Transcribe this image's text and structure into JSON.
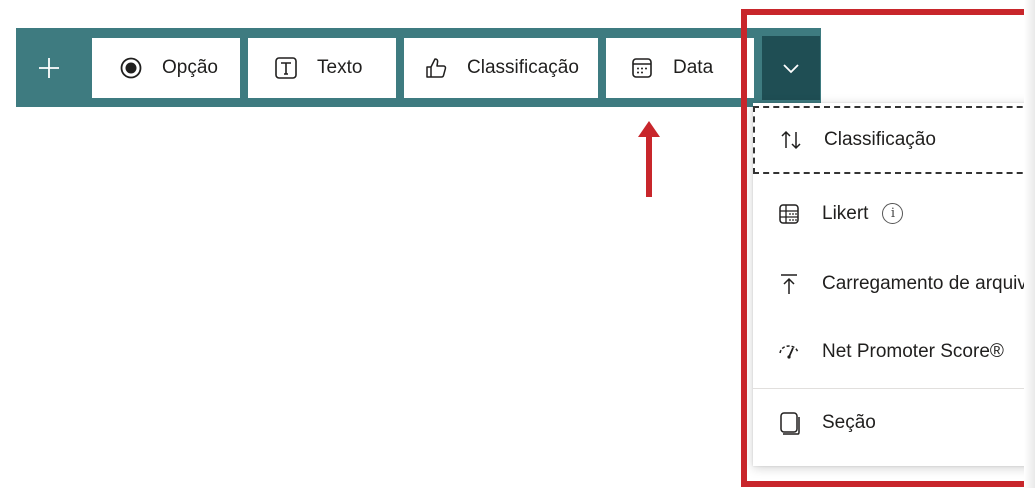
{
  "toolbar": {
    "buttons": [
      {
        "label": "Opção",
        "icon": "radio-icon"
      },
      {
        "label": "Texto",
        "icon": "text-box-icon"
      },
      {
        "label": "Classificação",
        "icon": "thumbs-up-icon"
      },
      {
        "label": "Data",
        "icon": "calendar-icon"
      }
    ],
    "add_icon": "plus-icon",
    "expand_icon": "chevron-down-icon"
  },
  "dropdown": {
    "items": [
      {
        "label": "Classificação",
        "icon": "sort-arrows-icon"
      },
      {
        "label": "Likert",
        "icon": "likert-table-icon"
      },
      {
        "label": "Carregamento de arquivo",
        "icon": "upload-icon"
      },
      {
        "label": "Net Promoter Score®",
        "icon": "gauge-icon"
      },
      {
        "label": "Seção",
        "icon": "section-icon"
      }
    ]
  },
  "colors": {
    "toolbar_bg": "#3e7b80",
    "expand_bg": "#1f4e54",
    "highlight": "#c8262b"
  }
}
